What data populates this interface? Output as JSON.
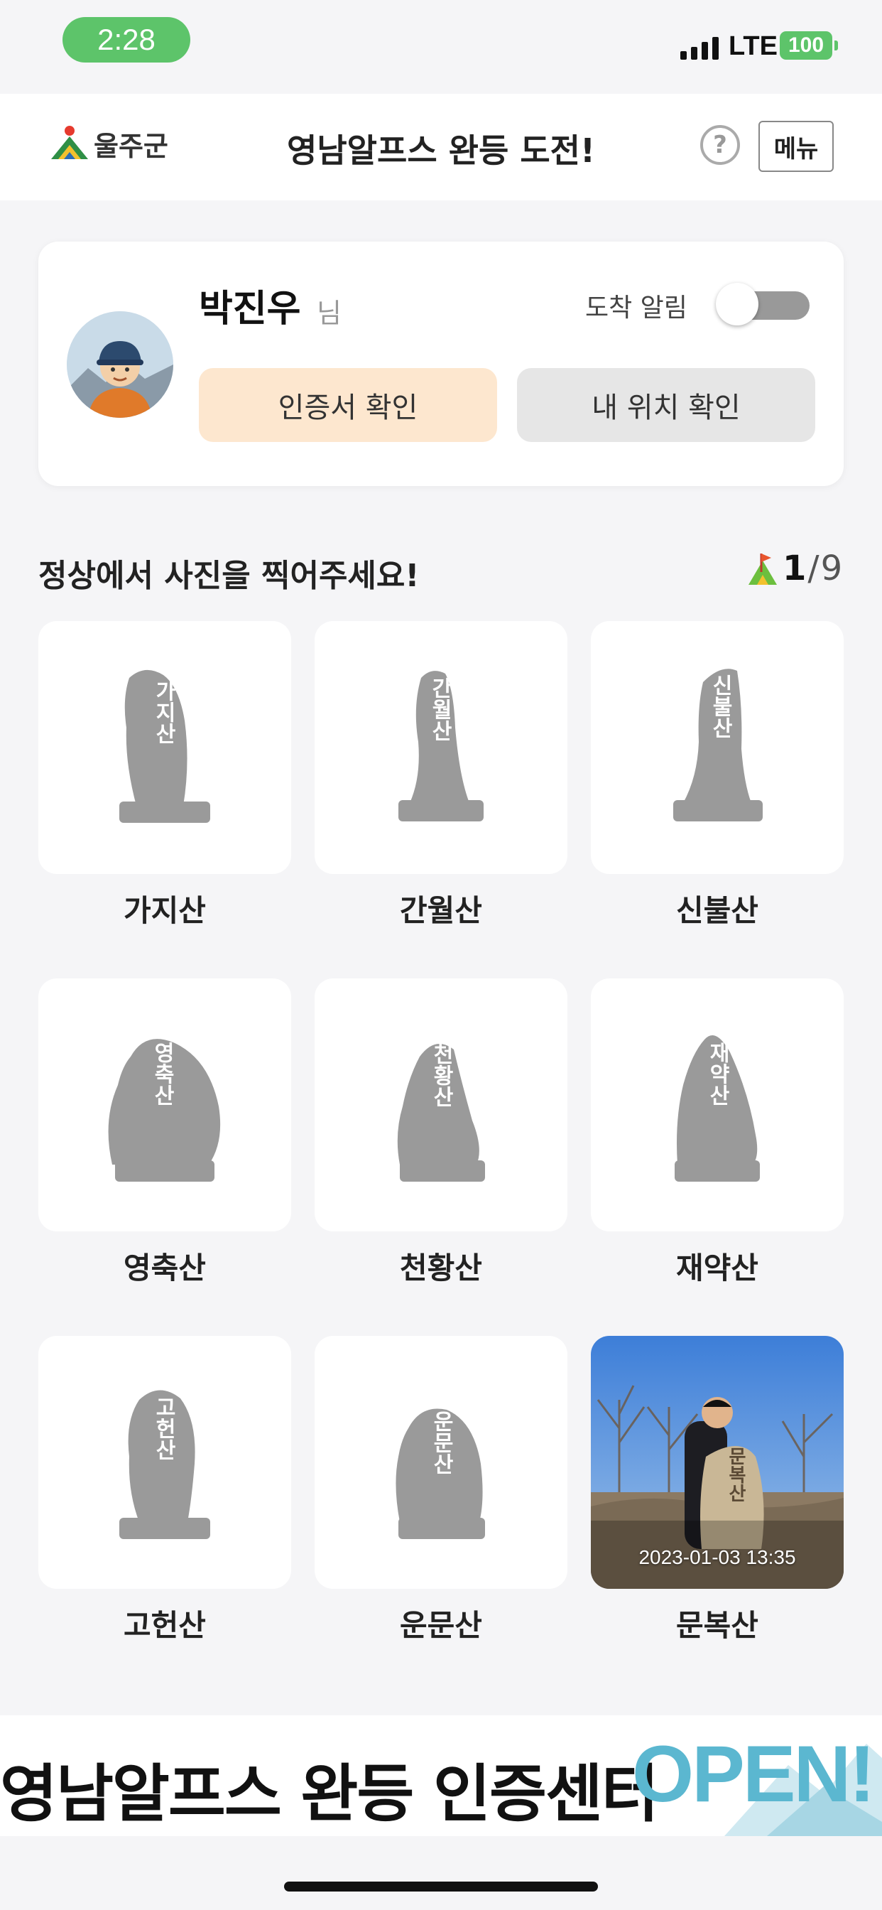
{
  "status_bar": {
    "time": "2:28",
    "network": "LTE",
    "battery": "100"
  },
  "header": {
    "logo_text": "울주군",
    "title": "영남알프스 완등 도전!",
    "help_label": "?",
    "menu_label": "메뉴"
  },
  "profile": {
    "name": "박진우",
    "suffix": "님",
    "arrival_alarm_label": "도착 알림",
    "arrival_alarm_on": false,
    "certificate_button": "인증서 확인",
    "location_button": "내 위치 확인"
  },
  "section": {
    "title": "정상에서 사진을 찍어주세요!",
    "completed": "1",
    "slash": "/",
    "total": "9"
  },
  "mountains": [
    {
      "name": "가지산",
      "stone_text": "가지산",
      "completed": false
    },
    {
      "name": "간월산",
      "stone_text": "간월산",
      "completed": false
    },
    {
      "name": "신불산",
      "stone_text": "신불산",
      "completed": false
    },
    {
      "name": "영축산",
      "stone_text": "영축산",
      "completed": false
    },
    {
      "name": "천황산",
      "stone_text": "천황산",
      "completed": false
    },
    {
      "name": "재약산",
      "stone_text": "재약산",
      "completed": false
    },
    {
      "name": "고헌산",
      "stone_text": "고헌산",
      "completed": false
    },
    {
      "name": "운문산",
      "stone_text": "운문산",
      "completed": false
    },
    {
      "name": "문복산",
      "stone_text": "문복산",
      "completed": true,
      "photo_timestamp": "2023-01-03 13:35"
    }
  ],
  "banner": {
    "text": "영남알프스 완등 인증센터",
    "highlight": "OPEN!"
  },
  "colors": {
    "accent_green": "#5dc46a",
    "cert_button_bg": "#fde7cf",
    "stone_gray": "#9a9a9a",
    "banner_blue": "#5bb7d0"
  }
}
